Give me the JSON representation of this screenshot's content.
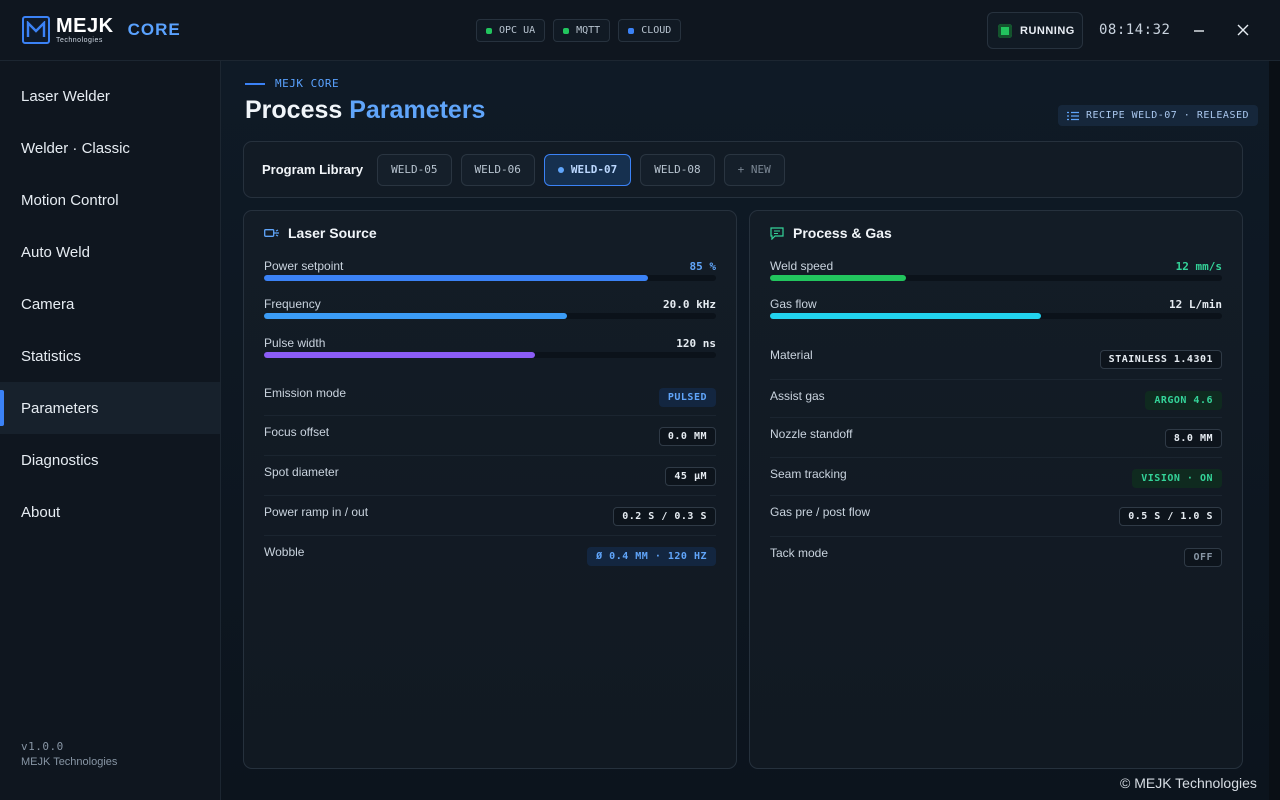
{
  "app": {
    "brand": "MEJK",
    "brand_sub": "Technologies",
    "product": "CORE"
  },
  "connections": [
    {
      "label": "OPC UA",
      "color": "#22c55e"
    },
    {
      "label": "MQTT",
      "color": "#22c55e"
    },
    {
      "label": "CLOUD",
      "color": "#3b82f6"
    }
  ],
  "status": {
    "label": "RUNNING",
    "color": "#22c55e"
  },
  "clock": "08:14:32",
  "sidebar": {
    "items": [
      {
        "label": "Laser Welder"
      },
      {
        "label": "Welder · Classic"
      },
      {
        "label": "Motion Control"
      },
      {
        "label": "Auto Weld"
      },
      {
        "label": "Camera"
      },
      {
        "label": "Statistics"
      },
      {
        "label": "Parameters",
        "active": true
      },
      {
        "label": "Diagnostics"
      },
      {
        "label": "About"
      }
    ],
    "version": "v1.0.0",
    "company": "MEJK Technologies"
  },
  "page": {
    "breadcrumb": "MEJK CORE",
    "title_main": "Process",
    "title_accent": "Parameters",
    "recipe_badge": "RECIPE WELD-07 · RELEASED"
  },
  "library": {
    "label": "Program Library",
    "programs": [
      "WELD-05",
      "WELD-06",
      "WELD-07",
      "WELD-08"
    ],
    "selected": "WELD-07",
    "new_label": "+ NEW"
  },
  "laser": {
    "title": "Laser Source",
    "bars": [
      {
        "label": "Power setpoint",
        "value": "85 %",
        "fraction": 0.85,
        "color": "#3b82f6",
        "value_color": "#60a5fa"
      },
      {
        "label": "Frequency",
        "value": "20.0 kHz",
        "fraction": 0.67,
        "color": "#3b9cf6",
        "value_color": "#e6ecf2"
      },
      {
        "label": "Pulse width",
        "value": "120 ns",
        "fraction": 0.6,
        "color": "#8b5cf6",
        "value_color": "#e6ecf2"
      }
    ],
    "fields": [
      {
        "label": "Emission mode",
        "value": "PULSED",
        "style": "blue"
      },
      {
        "label": "Focus offset",
        "value": "0.0 MM",
        "style": "plain"
      },
      {
        "label": "Spot diameter",
        "value": "45 µM",
        "style": "plain"
      },
      {
        "label": "Power ramp in / out",
        "value": "0.2 S / 0.3 S",
        "style": "plain"
      },
      {
        "label": "Wobble",
        "value": "Ø 0.4 MM · 120 HZ",
        "style": "blue"
      }
    ]
  },
  "gas": {
    "title": "Process & Gas",
    "bars": [
      {
        "label": "Weld speed",
        "value": "12 mm/s",
        "fraction": 0.3,
        "color": "#22c55e",
        "value_color": "#34d399"
      },
      {
        "label": "Gas flow",
        "value": "12 L/min",
        "fraction": 0.6,
        "color": "#22d3ee",
        "value_color": "#e6ecf2"
      }
    ],
    "fields": [
      {
        "label": "Material",
        "value": "STAINLESS 1.4301",
        "style": "plain"
      },
      {
        "label": "Assist gas",
        "value": "ARGON 4.6",
        "style": "green"
      },
      {
        "label": "Nozzle standoff",
        "value": "8.0 MM",
        "style": "plain"
      },
      {
        "label": "Seam tracking",
        "value": "VISION · ON",
        "style": "green"
      },
      {
        "label": "Gas pre / post flow",
        "value": "0.5 S / 1.0 S",
        "style": "plain"
      },
      {
        "label": "Tack mode",
        "value": "OFF",
        "style": "off"
      }
    ]
  },
  "watermark": "© MEJK Technologies"
}
